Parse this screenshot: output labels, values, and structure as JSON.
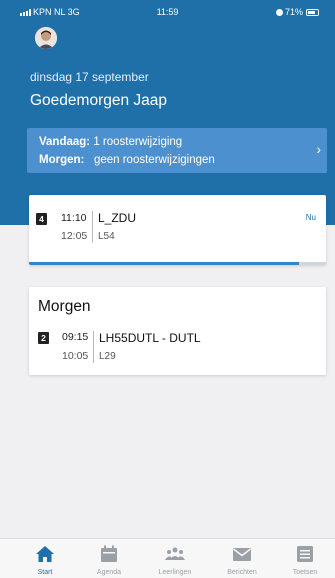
{
  "status_bar": {
    "carrier": "KPN NL 3G",
    "time": "11:59",
    "battery": "71%"
  },
  "header": {
    "date": "dinsdag 17 september",
    "greeting": "Goedemorgen Jaap"
  },
  "changes": {
    "today_label": "Vandaag:",
    "today_value": "1 roosterwijziging",
    "tomorrow_label": "Morgen:",
    "tomorrow_value": "geen roosterwijzigingen"
  },
  "current_lesson": {
    "period": "4",
    "start": "11:10",
    "end": "12:05",
    "subject": "L_ZDU",
    "room": "L54",
    "now_label": "Nu",
    "progress_fraction": 0.91
  },
  "tomorrow": {
    "title": "Morgen",
    "lesson": {
      "period": "2",
      "start": "09:15",
      "end": "10:05",
      "subject": "LH55DUTL - DUTL",
      "room": "L29"
    }
  },
  "tabbar": {
    "tabs": [
      {
        "label": "Start",
        "icon": "home-icon",
        "active": true
      },
      {
        "label": "Agenda",
        "icon": "calendar-icon",
        "active": false
      },
      {
        "label": "Leerlingen",
        "icon": "students-icon",
        "active": false
      },
      {
        "label": "Berichten",
        "icon": "mail-icon",
        "active": false
      },
      {
        "label": "Toetsen",
        "icon": "list-icon",
        "active": false
      }
    ]
  },
  "colors": {
    "header_bg": "#1f6fa8",
    "changes_bg": "#4d90cf",
    "accent": "#2f86c9",
    "tab_inactive": "#9aa0a6"
  }
}
